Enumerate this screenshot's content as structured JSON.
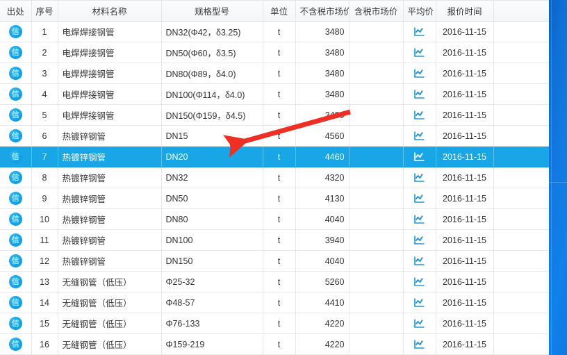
{
  "table": {
    "columns": [
      {
        "key": "source",
        "label": "出处"
      },
      {
        "key": "seq",
        "label": "序号"
      },
      {
        "key": "name",
        "label": "材料名称"
      },
      {
        "key": "spec",
        "label": "规格型号"
      },
      {
        "key": "unit",
        "label": "单位"
      },
      {
        "key": "ntax",
        "label": "不含税市场价"
      },
      {
        "key": "tax",
        "label": "含税市场价"
      },
      {
        "key": "avg",
        "label": "平均价"
      },
      {
        "key": "time",
        "label": "报价时间"
      }
    ],
    "source_badge_label": "信",
    "avg_icon": "line-chart-icon",
    "selected_row_index": 6,
    "rows": [
      {
        "seq": "1",
        "name": "电焊焊接钢管",
        "spec": "DN32(Φ42，δ3.25)",
        "unit": "t",
        "ntax": "3480",
        "tax": "",
        "time": "2016-11-15"
      },
      {
        "seq": "2",
        "name": "电焊焊接钢管",
        "spec": "DN50(Φ60，δ3.5)",
        "unit": "t",
        "ntax": "3480",
        "tax": "",
        "time": "2016-11-15"
      },
      {
        "seq": "3",
        "name": "电焊焊接钢管",
        "spec": "DN80(Φ89，δ4.0)",
        "unit": "t",
        "ntax": "3480",
        "tax": "",
        "time": "2016-11-15"
      },
      {
        "seq": "4",
        "name": "电焊焊接钢管",
        "spec": "DN100(Φ114，δ4.0)",
        "unit": "t",
        "ntax": "3480",
        "tax": "",
        "time": "2016-11-15"
      },
      {
        "seq": "5",
        "name": "电焊焊接钢管",
        "spec": "DN150(Φ159，δ4.5)",
        "unit": "t",
        "ntax": "3480",
        "tax": "",
        "time": "2016-11-15"
      },
      {
        "seq": "6",
        "name": "热镀锌钢管",
        "spec": "DN15",
        "unit": "t",
        "ntax": "4560",
        "tax": "",
        "time": "2016-11-15"
      },
      {
        "seq": "7",
        "name": "热镀锌钢管",
        "spec": "DN20",
        "unit": "t",
        "ntax": "4460",
        "tax": "",
        "time": "2016-11-15"
      },
      {
        "seq": "8",
        "name": "热镀锌钢管",
        "spec": "DN32",
        "unit": "t",
        "ntax": "4320",
        "tax": "",
        "time": "2016-11-15"
      },
      {
        "seq": "9",
        "name": "热镀锌钢管",
        "spec": "DN50",
        "unit": "t",
        "ntax": "4130",
        "tax": "",
        "time": "2016-11-15"
      },
      {
        "seq": "10",
        "name": "热镀锌钢管",
        "spec": "DN80",
        "unit": "t",
        "ntax": "4040",
        "tax": "",
        "time": "2016-11-15"
      },
      {
        "seq": "11",
        "name": "热镀锌钢管",
        "spec": "DN100",
        "unit": "t",
        "ntax": "3940",
        "tax": "",
        "time": "2016-11-15"
      },
      {
        "seq": "12",
        "name": "热镀锌钢管",
        "spec": "DN150",
        "unit": "t",
        "ntax": "4040",
        "tax": "",
        "time": "2016-11-15"
      },
      {
        "seq": "13",
        "name": "无缝钢管（低压）",
        "spec": "Φ25-32",
        "unit": "t",
        "ntax": "5260",
        "tax": "",
        "time": "2016-11-15"
      },
      {
        "seq": "14",
        "name": "无缝钢管（低压）",
        "spec": "Φ48-57",
        "unit": "t",
        "ntax": "4410",
        "tax": "",
        "time": "2016-11-15"
      },
      {
        "seq": "15",
        "name": "无缝钢管（低压）",
        "spec": "Φ76-133",
        "unit": "t",
        "ntax": "4220",
        "tax": "",
        "time": "2016-11-15"
      },
      {
        "seq": "16",
        "name": "无缝钢管（低压）",
        "spec": "Φ159-219",
        "unit": "t",
        "ntax": "4220",
        "tax": "",
        "time": "2016-11-15"
      }
    ]
  },
  "annotation": {
    "type": "red-arrow",
    "color": "#ee2f24",
    "points_to_row_seq": "7"
  },
  "colors": {
    "selected_row_bg": "#19a6e6",
    "badge_blue": "#13a3e6",
    "icon_blue": "#1b97d9",
    "header_bg": "#f3f5f7",
    "grid_line": "#e4e7ea",
    "right_panel_blue": "#1279e0",
    "annotation_red": "#ee2f24"
  }
}
